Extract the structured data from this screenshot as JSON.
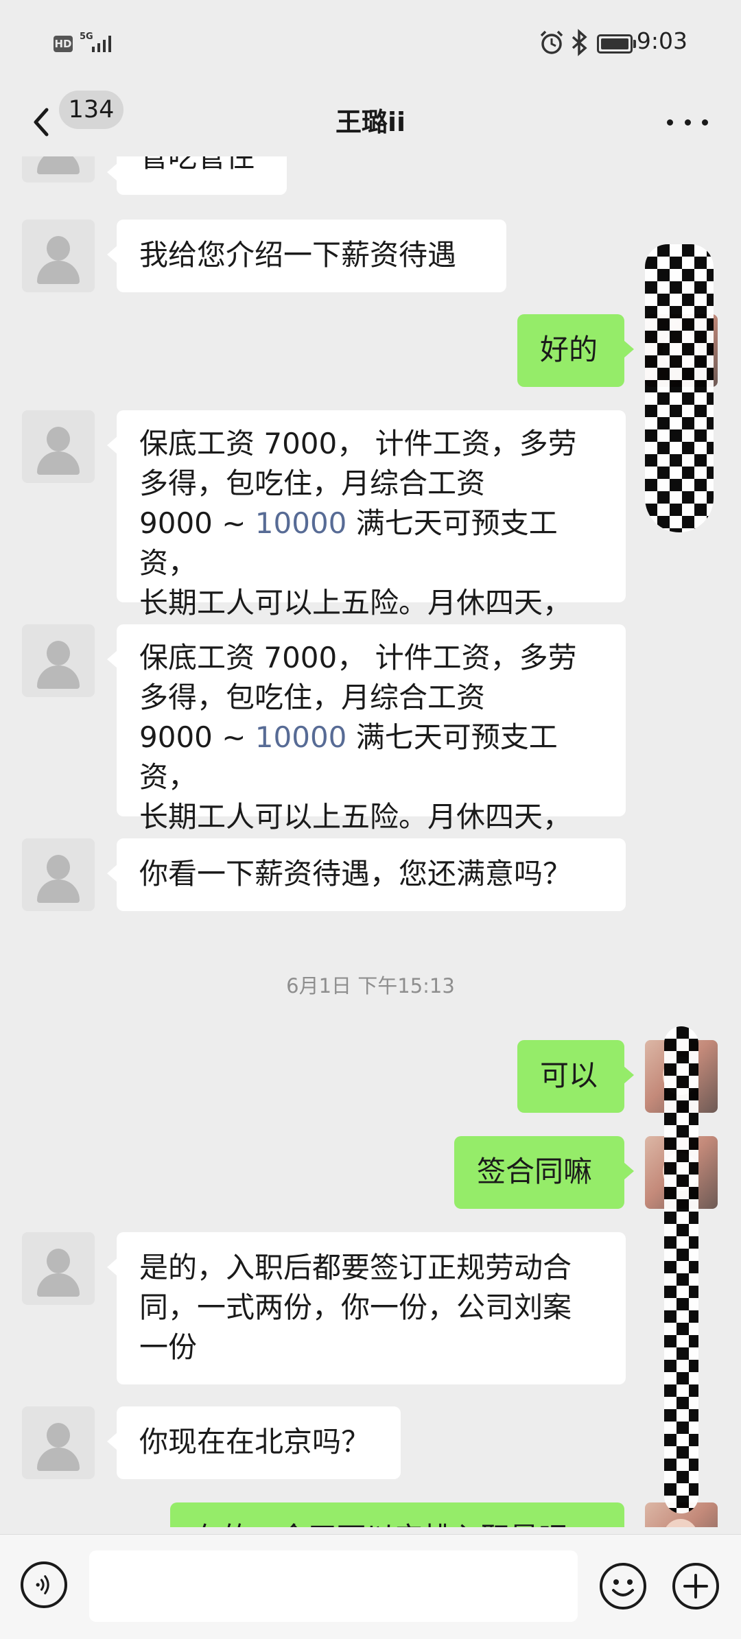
{
  "status_bar": {
    "hd_badge": "HD",
    "network": "5G",
    "time": "9:03",
    "icons": [
      "signal-icon",
      "alarm-icon",
      "bluetooth-icon",
      "battery-icon"
    ]
  },
  "header": {
    "unread_count": "134",
    "title": "王璐ii",
    "more_icon": "more-icon",
    "back_icon": "back-icon"
  },
  "messages": [
    {
      "side": "left",
      "text": "管吃管住"
    },
    {
      "side": "left",
      "text": "我给您介绍一下薪资待遇"
    },
    {
      "side": "right",
      "text": "好的"
    },
    {
      "side": "left",
      "lines": [
        "保底工资 7000， 计件工资，多劳",
        "多得，包吃住，月综合工资",
        "9000 ~ ",
        "10000",
        " 满七天可预支工资，",
        "长期工人可以上五险。月休四天，"
      ]
    },
    {
      "side": "left",
      "lines": [
        "保底工资 7000， 计件工资，多劳",
        "多得，包吃住，月综合工资",
        "9000 ~ ",
        "10000",
        " 满七天可预支工资，",
        "长期工人可以上五险。月休四天，"
      ]
    },
    {
      "side": "left",
      "text": "你看一下薪资待遇，您还满意吗？"
    },
    {
      "side": "right",
      "text": "可以"
    },
    {
      "side": "right",
      "text": "签合同嘛"
    },
    {
      "side": "left",
      "lines": [
        "是的，入职后都要签订正规劳动合",
        "同，一式两份，你一份，公司刘案",
        "一份"
      ]
    },
    {
      "side": "left",
      "text": "你现在在北京吗？"
    },
    {
      "side": "right",
      "text": "在的，今天可以安排入职是吧"
    }
  ],
  "timestamp": "6月1日 下午15:13",
  "input_bar": {
    "placeholder": "",
    "voice_icon": "voice-icon",
    "emoji_icon": "emoji-icon",
    "plus_icon": "plus-icon"
  },
  "colors": {
    "background": "#ededed",
    "sent_bubble": "#95ec69",
    "received_bubble": "#ffffff",
    "link": "#576b95"
  }
}
